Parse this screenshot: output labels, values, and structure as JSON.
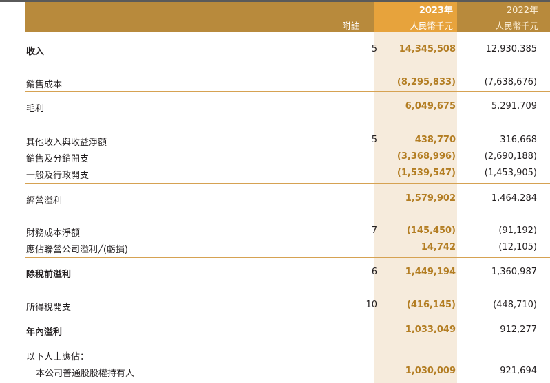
{
  "header": {
    "note_label": "附註",
    "current_year": "2023年",
    "current_unit": "人民幣千元",
    "previous_year": "2022年",
    "previous_unit": "人民幣千元"
  },
  "rows": [
    {
      "label": "收入",
      "note": "5",
      "current": "14,345,508",
      "previous": "12,930,385"
    },
    {
      "label": "銷售成本",
      "note": "",
      "current": "(8,295,833)",
      "previous": "(7,638,676)"
    },
    {
      "label": "毛利",
      "note": "",
      "current": "6,049,675",
      "previous": "5,291,709"
    },
    {
      "label": "其他收入與收益淨額",
      "note": "5",
      "current": "438,770",
      "previous": "316,668"
    },
    {
      "label": "銷售及分銷開支",
      "note": "",
      "current": "(3,368,996)",
      "previous": "(2,690,188)"
    },
    {
      "label": "一般及行政開支",
      "note": "",
      "current": "(1,539,547)",
      "previous": "(1,453,905)"
    },
    {
      "label": "經營溢利",
      "note": "",
      "current": "1,579,902",
      "previous": "1,464,284"
    },
    {
      "label": "財務成本淨額",
      "note": "7",
      "current": "(145,450)",
      "previous": "(91,192)"
    },
    {
      "label": "應佔聯營公司溢利╱(虧損)",
      "note": "",
      "current": "14,742",
      "previous": "(12,105)"
    },
    {
      "label": "除稅前溢利",
      "note": "6",
      "current": "1,449,194",
      "previous": "1,360,987"
    },
    {
      "label": "所得稅開支",
      "note": "10",
      "current": "(416,145)",
      "previous": "(448,710)"
    },
    {
      "label": "年內溢利",
      "note": "",
      "current": "1,033,049",
      "previous": "912,277"
    },
    {
      "label": "以下人士應佔：",
      "note": "",
      "current": "",
      "previous": ""
    },
    {
      "label": "本公司普通股股權持有人",
      "note": "",
      "current": "1,030,009",
      "previous": "921,694"
    }
  ]
}
